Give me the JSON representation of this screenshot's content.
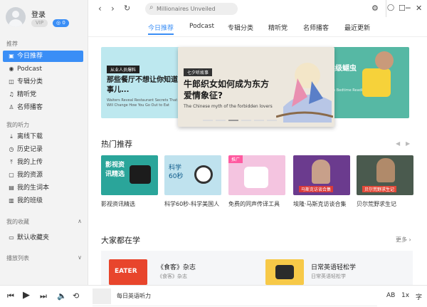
{
  "sidebar": {
    "login": "登录",
    "vip": "VIP",
    "coins": "0",
    "section_recommend": "推荐",
    "recommend_items": [
      "今日推荐",
      "Podcast",
      "专辑分类",
      "精听党",
      "名师播客"
    ],
    "section_listen": "我的听力",
    "listen_items": [
      "离线下载",
      "历史记录",
      "我的上传",
      "我的资源",
      "我的生词本",
      "我的班级"
    ],
    "section_fav": "我的收藏",
    "fav_items": [
      "默认收藏夹"
    ],
    "section_playlist": "播放列表"
  },
  "topbar": {
    "search_placeholder": "Millionaires Unveiled"
  },
  "tabs": [
    "今日推荐",
    "Podcast",
    "专辑分类",
    "精听党",
    "名师播客",
    "最近更新"
  ],
  "banner": {
    "left_tag": "从业人员爆料",
    "left_title": "那些餐厅不想让你知道的事儿...",
    "left_sub": "Waiters Reveal Restaurant Secrets That Will Change How You Go Out to Eat",
    "center_tag": "七夕听故事",
    "center_title": "牛郎织女如何成为东方爱情象征?",
    "center_sub": "The Chinese myth of the forbidden lovers",
    "right_title": "读级蝴虫",
    "right_sub": "Tom Bedtime Reading for Toddler"
  },
  "hot": {
    "title": "热门推荐",
    "cards": [
      {
        "label": "影视资讯精选",
        "image_text": "影视资讯精选"
      },
      {
        "label": "科学60秒-科学美国人",
        "image_text": "科学60秒"
      },
      {
        "label": "免费的同声传译工具",
        "image_text": "推广"
      },
      {
        "label": "埃隆·马斯克访谈合集",
        "image_text": "马斯克访谈合集"
      },
      {
        "label": "贝尔荒野求生记",
        "image_text": "贝尔荒野求生记"
      }
    ]
  },
  "learning": {
    "title": "大家都在学",
    "more": "更多",
    "items": [
      {
        "title": "《食客》杂志",
        "sub": "《食客》杂志",
        "image_text": "EATER"
      },
      {
        "title": "日常英语轻松学",
        "sub": "日常英语轻松学"
      }
    ]
  },
  "player": {
    "title": "每日英语听力",
    "ab": "AB",
    "speed": "1x",
    "subtitle": "字"
  },
  "colors": {
    "accent": "#3a8ef6",
    "sidebar_bg": "#f3f3f3"
  }
}
